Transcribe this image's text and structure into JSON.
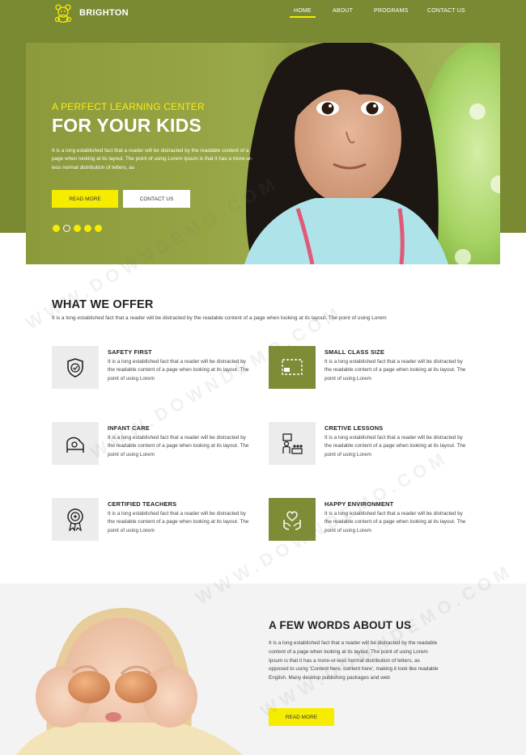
{
  "nav": {
    "brand": "BRIGHTON",
    "items": [
      {
        "label": "HOME",
        "active": true
      },
      {
        "label": "ABOUT",
        "active": false
      },
      {
        "label": "PROGRAMS",
        "active": false
      },
      {
        "label": "CONTACT US",
        "active": false
      }
    ]
  },
  "hero": {
    "tagline": "A PERFECT LEARNING CENTER",
    "title": "FOR YOUR KIDS",
    "description": "It is a long established fact that a reader will be distracted by the readable content of a page when looking at its layout. The point of using Lorem Ipsum is that it has a more-or-less normal distribution of letters, as",
    "read_more": "READ MORE",
    "contact": "CONTACT US",
    "slides": 5,
    "active_slide": 2
  },
  "offer": {
    "title": "WHAT WE OFFER",
    "subtitle": "It is a long established fact that a reader will be distracted by the readable content of a page when looking at its layout. The point of using Lorem",
    "features": [
      {
        "title": "SAFETY FIRST",
        "icon": "shield-icon",
        "highlight": false,
        "desc": "It is a long established fact that a reader will be distracted by the readable content of a page when looking at its layout. The point of using Lorem"
      },
      {
        "title": "SMALL CLASS SIZE",
        "icon": "classroom-icon",
        "highlight": true,
        "desc": "It is a long established fact that a reader will be distracted by the readable content of a page when looking at its layout. The point of using Lorem"
      },
      {
        "title": "INFANT CARE",
        "icon": "crib-icon",
        "highlight": false,
        "desc": "It is a long established fact that a reader will be distracted by the readable content of a page when looking at its layout. The point of using Lorem"
      },
      {
        "title": "CRETIVE LESSONS",
        "icon": "teacher-icon",
        "highlight": false,
        "desc": "It is a long established fact that a reader will be distracted by the readable content of a page when looking at its layout. The point of using Lorem"
      },
      {
        "title": "CERTIFIED TEACHERS",
        "icon": "award-icon",
        "highlight": false,
        "desc": "It is a long established fact that a reader will be distracted by the readable content of a page when looking at its layout. The point of using Lorem"
      },
      {
        "title": "HAPPY ENVIRONMENT",
        "icon": "hands-icon",
        "highlight": true,
        "desc": "It is a long established fact that a reader will be distracted by the readable content of a page when looking at its layout. The point of using Lorem"
      }
    ]
  },
  "about": {
    "title": "A FEW WORDS ABOUT US",
    "description": "It is a long established fact that a reader will be distracted by the readable content of a page when looking at its layout. The point of using Lorem Ipsum is that it has a more-or-less normal distribution of letters, as opposed to using 'Content here, content here', making it look like readable English. Many desktop publishing packages and web",
    "read_more": "READ MORE"
  },
  "watermark": "WWW.DOWNDEMO.COM",
  "colors": {
    "olive": "#7a8a33",
    "accent_yellow": "#f6ec00",
    "tile_gray": "#ececec"
  }
}
